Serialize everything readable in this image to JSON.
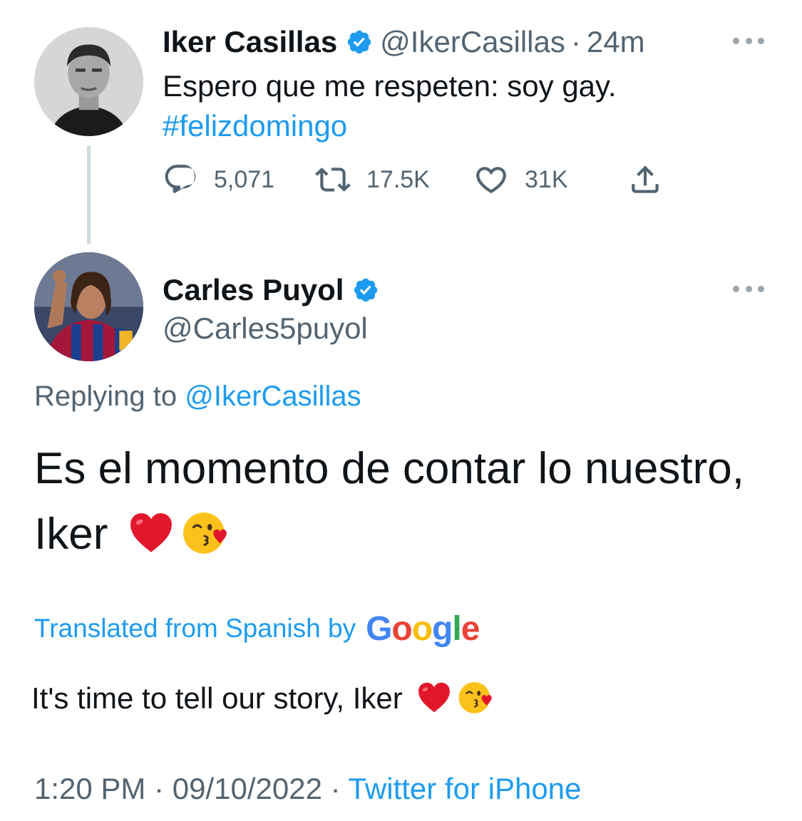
{
  "parent_tweet": {
    "author_name": "Iker Casillas",
    "author_handle": "@IkerCasillas",
    "separator": "·",
    "time_ago": "24m",
    "text": "Espero que me respeten: soy gay.",
    "hashtag": "#felizdomingo",
    "metrics": {
      "replies": "5,071",
      "retweets": "17.5K",
      "likes": "31K"
    }
  },
  "reply_tweet": {
    "author_name": "Carles Puyol",
    "author_handle": "@Carles5puyol",
    "replying_prefix": "Replying to",
    "replying_to": "@IkerCasillas",
    "text_line1": "Es el momento de contar lo nuestro,",
    "text_line2": "Iker",
    "translated_label": "Translated from Spanish by",
    "google_letters": [
      "G",
      "o",
      "o",
      "g",
      "l",
      "e"
    ],
    "translation_text": "It's time to tell our story, Iker",
    "time": "1:20 PM",
    "separator": "·",
    "date": "09/10/2022",
    "source": "Twitter for iPhone"
  },
  "icons": {
    "verified": "verified-badge-icon",
    "reply": "reply-icon",
    "retweet": "retweet-icon",
    "like": "heart-icon",
    "share": "share-icon",
    "more": "more-icon",
    "heart_emoji": "red-heart-emoji",
    "kiss_emoji": "face-blowing-kiss-emoji"
  },
  "colors": {
    "link_blue": "#1d9bf0",
    "secondary_gray": "#536471",
    "primary_text": "#0f1419",
    "google_blue": "#4285f4",
    "google_red": "#ea4335",
    "google_yellow": "#fbbc05",
    "google_green": "#34a853"
  }
}
